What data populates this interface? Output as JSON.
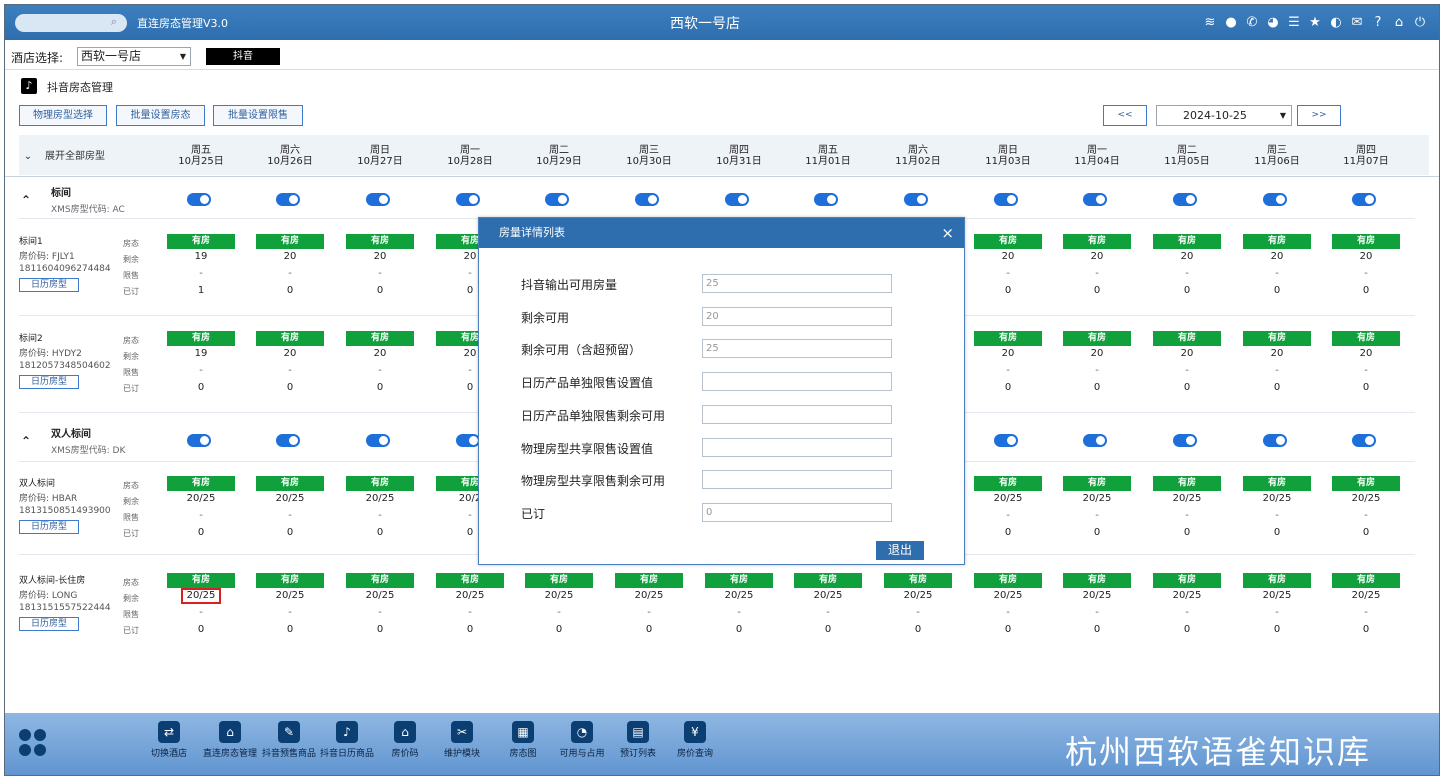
{
  "topbar": {
    "app_title": "直连房态管理V3.0",
    "store_title": "西软一号店"
  },
  "hotel_select": {
    "label": "酒店选择:",
    "value": "西软一号店",
    "channel": "抖音"
  },
  "page_title": "抖音房态管理",
  "toolbar": {
    "physical_room": "物理房型选择",
    "batch_status": "批量设置房态",
    "batch_limit": "批量设置限售",
    "prev": "<<",
    "next": ">>",
    "date": "2024-10-25"
  },
  "header": {
    "expand_label": "展开全部房型"
  },
  "dates": [
    {
      "wd": "周五",
      "d": "10月25日"
    },
    {
      "wd": "周六",
      "d": "10月26日"
    },
    {
      "wd": "周日",
      "d": "10月27日"
    },
    {
      "wd": "周一",
      "d": "10月28日"
    },
    {
      "wd": "周二",
      "d": "10月29日"
    },
    {
      "wd": "周三",
      "d": "10月30日"
    },
    {
      "wd": "周四",
      "d": "10月31日"
    },
    {
      "wd": "周五",
      "d": "11月01日"
    },
    {
      "wd": "周六",
      "d": "11月02日"
    },
    {
      "wd": "周日",
      "d": "11月03日"
    },
    {
      "wd": "周一",
      "d": "11月04日"
    },
    {
      "wd": "周二",
      "d": "11月05日"
    },
    {
      "wd": "周三",
      "d": "11月06日"
    },
    {
      "wd": "周四",
      "d": "11月07日"
    }
  ],
  "labels": {
    "status": "房态",
    "remain": "剩余",
    "limit": "限售",
    "booked": "已订",
    "cal_btn": "日历房型",
    "has_room": "有房",
    "dash": "-"
  },
  "types": [
    {
      "name": "标间",
      "code": "XMS房型代码: AC"
    },
    {
      "name": "双人标间",
      "code": "XMS房型代码: DK"
    }
  ],
  "products": [
    {
      "name": "标间1",
      "code": "房价码: FJLY1",
      "id": "1811604096274484",
      "remain": [
        "19",
        "20",
        "20",
        "20",
        "",
        "",
        "",
        "",
        "",
        "20",
        "20",
        "20",
        "20",
        "20"
      ],
      "booked": [
        "1",
        "0",
        "0",
        "0",
        "",
        "",
        "",
        "",
        "",
        "0",
        "0",
        "0",
        "0",
        "0"
      ]
    },
    {
      "name": "标间2",
      "code": "房价码: HYDY2",
      "id": "1812057348504602",
      "remain": [
        "19",
        "20",
        "20",
        "20",
        "",
        "",
        "",
        "",
        "",
        "20",
        "20",
        "20",
        "20",
        "20"
      ],
      "booked": [
        "0",
        "0",
        "0",
        "0",
        "",
        "",
        "",
        "",
        "",
        "0",
        "0",
        "0",
        "0",
        "0"
      ]
    },
    {
      "name": "双人标间",
      "code": "房价码: HBAR",
      "id": "1813150851493900",
      "remain": [
        "20/25",
        "20/25",
        "20/25",
        "20/2",
        "",
        "",
        "",
        "",
        "",
        "20/25",
        "20/25",
        "20/25",
        "20/25",
        "20/25"
      ],
      "booked": [
        "0",
        "0",
        "0",
        "0",
        "",
        "",
        "",
        "",
        "",
        "0",
        "0",
        "0",
        "0",
        "0"
      ]
    },
    {
      "name": "双人标间-长住房",
      "code": "房价码: LONG",
      "id": "1813151557522444",
      "remain": [
        "20/25",
        "20/25",
        "20/25",
        "20/25",
        "20/25",
        "20/25",
        "20/25",
        "20/25",
        "20/25",
        "20/25",
        "20/25",
        "20/25",
        "20/25",
        "20/25"
      ],
      "booked": [
        "0",
        "0",
        "0",
        "0",
        "0",
        "0",
        "0",
        "0",
        "0",
        "0",
        "0",
        "0",
        "0",
        "0"
      ]
    }
  ],
  "modal": {
    "title": "房量详情列表",
    "close": "×",
    "rows": [
      {
        "label": "抖音输出可用房量",
        "value": "25"
      },
      {
        "label": "剩余可用",
        "value": "20"
      },
      {
        "label": "剩余可用（含超预留）",
        "value": "25"
      },
      {
        "label": "日历产品单独限售设置值",
        "value": ""
      },
      {
        "label": "日历产品单独限售剩余可用",
        "value": ""
      },
      {
        "label": "物理房型共享限售设置值",
        "value": ""
      },
      {
        "label": "物理房型共享限售剩余可用",
        "value": ""
      },
      {
        "label": "已订",
        "value": "0"
      }
    ],
    "exit": "退出"
  },
  "footer": {
    "items": [
      "切换酒店",
      "直连房态管理",
      "抖音预售商品",
      "抖音日历商品",
      "房价码",
      "维护模块",
      "房态图",
      "可用与占用",
      "预订列表",
      "房价查询"
    ],
    "brand": "杭州西软语雀知识库"
  }
}
